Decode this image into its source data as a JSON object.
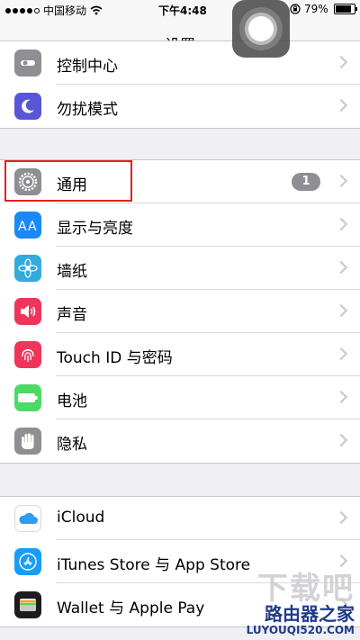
{
  "status_bar": {
    "carrier": "中国移动",
    "time": "下午4:48",
    "battery": "79%",
    "battery_fraction": 0.79,
    "signal_filled": 4,
    "signal_total": 5
  },
  "nav": {
    "title": "设置"
  },
  "groups": [
    {
      "items": [
        {
          "label": "控制中心",
          "icon": "control-center-icon",
          "color": "#8e8e93"
        },
        {
          "label": "勿扰模式",
          "icon": "moon-icon",
          "color": "#5856d6"
        }
      ]
    },
    {
      "items": [
        {
          "label": "通用",
          "icon": "gear-icon",
          "color": "#8e8e93",
          "badge": "1"
        },
        {
          "label": "显示与亮度",
          "icon": "display-brightness-icon",
          "color": "#1b88f7"
        },
        {
          "label": "墙纸",
          "icon": "wallpaper-flower-icon",
          "color": "#35aadc"
        },
        {
          "label": "声音",
          "icon": "speaker-icon",
          "color": "#f0355b"
        },
        {
          "label": "Touch ID 与密码",
          "icon": "fingerprint-icon",
          "color": "#f0355b"
        },
        {
          "label": "电池",
          "icon": "battery-icon",
          "color": "#4cd964"
        },
        {
          "label": "隐私",
          "icon": "hand-icon",
          "color": "#8e8e93"
        }
      ]
    },
    {
      "items": [
        {
          "label": "iCloud",
          "icon": "icloud-icon",
          "color": "#ffffff"
        },
        {
          "label": "iTunes Store 与 App Store",
          "icon": "app-store-icon",
          "color": "#1a9cf5"
        },
        {
          "label": "Wallet 与 Apple Pay",
          "icon": "wallet-icon",
          "color": "#1c1c1e"
        }
      ]
    }
  ],
  "watermark": {
    "big": "下载吧",
    "cn": "路由器之家",
    "url": "LUYOUQI520.COM"
  }
}
